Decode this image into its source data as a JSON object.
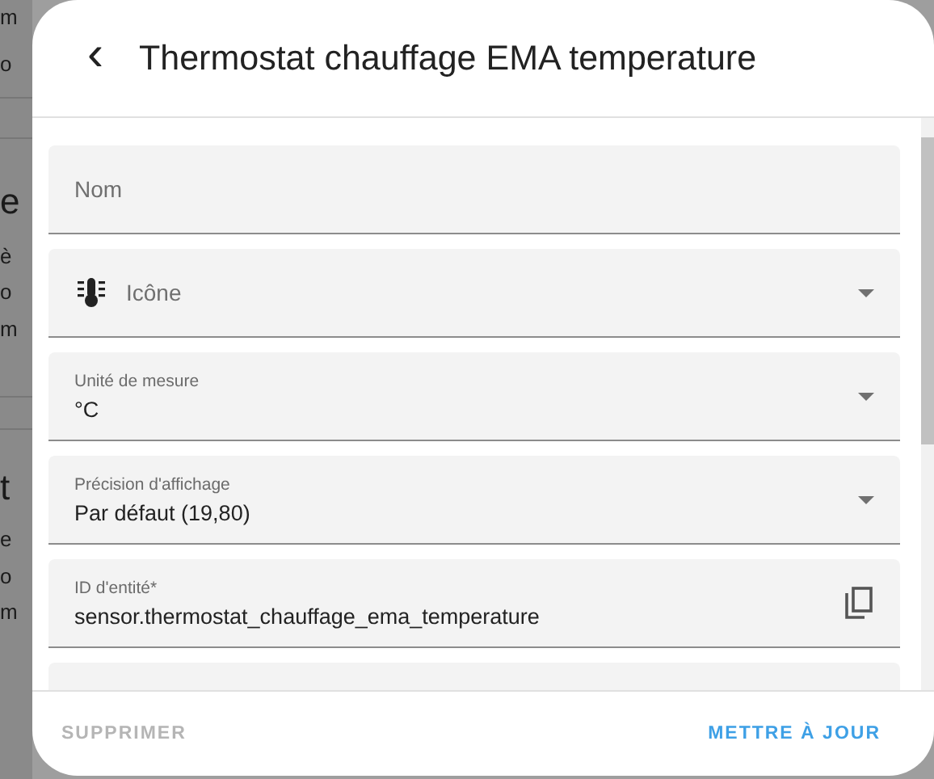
{
  "background_fragments": [
    "m",
    "o",
    "e",
    "è",
    "o",
    "m",
    "t",
    "e",
    "o",
    "m"
  ],
  "dialog": {
    "back": "‹",
    "title": "Thermostat chauffage EMA temperature"
  },
  "fields": [
    {
      "kind": "text",
      "label": "Nom"
    },
    {
      "kind": "icon",
      "label": "Icône"
    },
    {
      "kind": "select",
      "label": "Unité de mesure",
      "value": "°C"
    },
    {
      "kind": "select",
      "label": "Précision d'affichage",
      "value": "Par défaut (19,80)"
    },
    {
      "kind": "copy",
      "label": "ID d'entité*",
      "value": "sensor.thermostat_chauffage_ema_temperature"
    },
    {
      "kind": "partial"
    }
  ],
  "footer": {
    "delete": "SUPPRIMER",
    "update": "METTRE À JOUR"
  }
}
